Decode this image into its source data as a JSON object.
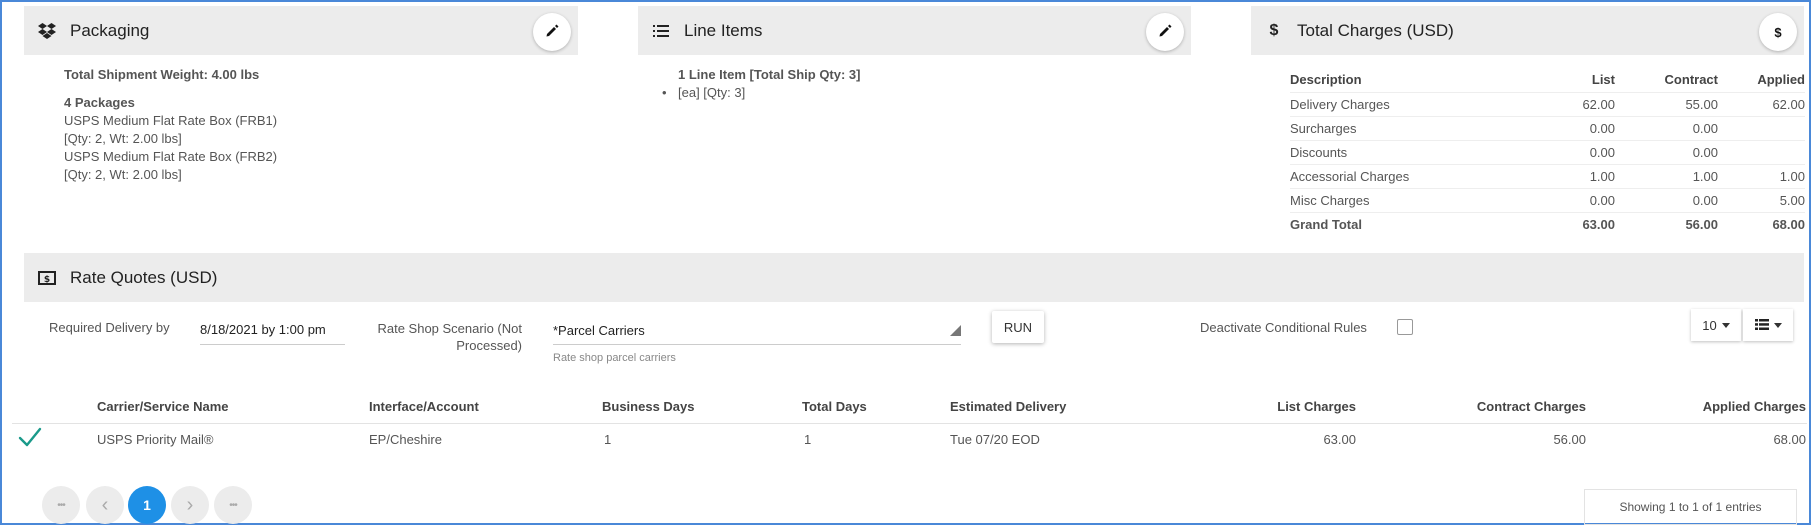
{
  "packaging": {
    "title": "Packaging",
    "total_weight": "Total Shipment Weight: 4.00 lbs",
    "packages_count": "4 Packages",
    "items": [
      {
        "name": "USPS Medium Flat Rate Box (FRB1)",
        "detail": "[Qty: 2, Wt: 2.00 lbs]"
      },
      {
        "name": "USPS Medium Flat Rate Box (FRB2)",
        "detail": "[Qty: 2, Wt: 2.00 lbs]"
      }
    ]
  },
  "line_items": {
    "title": "Line Items",
    "summary": "1 Line Item [Total Ship Qty: 3]",
    "items": [
      "[ea] [Qty: 3]"
    ]
  },
  "total_charges": {
    "title": "Total Charges (USD)",
    "button_symbol": "$",
    "headers": [
      "Description",
      "List",
      "Contract",
      "Applied"
    ],
    "rows": [
      {
        "desc": "Delivery Charges",
        "list": "62.00",
        "contract": "55.00",
        "applied": "62.00",
        "list_link": true,
        "contract_link": true,
        "applied_link": true
      },
      {
        "desc": "Surcharges",
        "list": "0.00",
        "contract": "0.00",
        "applied": "",
        "list_link": false,
        "contract_link": false,
        "applied_link": false
      },
      {
        "desc": "Discounts",
        "list": "0.00",
        "contract": "0.00",
        "applied": "",
        "list_link": false,
        "contract_link": false,
        "applied_link": false
      },
      {
        "desc": "Accessorial Charges",
        "list": "1.00",
        "contract": "1.00",
        "applied": "1.00",
        "list_link": true,
        "contract_link": true,
        "applied_link": true
      },
      {
        "desc": "Misc Charges",
        "list": "0.00",
        "contract": "0.00",
        "applied": "5.00",
        "list_link": false,
        "contract_link": false,
        "applied_link": true
      }
    ],
    "grand_total": {
      "desc": "Grand Total",
      "list": "63.00",
      "contract": "56.00",
      "applied": "68.00"
    }
  },
  "rate_quotes": {
    "title": "Rate Quotes (USD)",
    "required_delivery_label": "Required Delivery by",
    "required_delivery_value": "8/18/2021 by 1:00 pm",
    "scenario_label_1": "Rate Shop Scenario (Not",
    "scenario_label_2": "Processed)",
    "scenario_value": "*Parcel Carriers",
    "scenario_hint": "Rate shop parcel carriers",
    "run_label": "RUN",
    "deactivate_label": "Deactivate Conditional Rules",
    "page_size": "10",
    "columns": {
      "carrier": "Carrier/Service Name",
      "interface": "Interface/Account",
      "business_days": "Business Days",
      "total_days": "Total Days",
      "est_delivery": "Estimated Delivery",
      "list": "List Charges",
      "contract": "Contract Charges",
      "applied": "Applied Charges"
    },
    "rows": [
      {
        "carrier": "USPS Priority Mail®",
        "interface": "EP/Cheshire",
        "business_days": "1",
        "total_days": "1",
        "est_delivery": "Tue 07/20 EOD",
        "list": "63.00",
        "contract": "56.00",
        "applied": "68.00"
      }
    ],
    "pagination": {
      "first": "•••",
      "prev": "‹",
      "current": "1",
      "next": "›",
      "last": "•••"
    },
    "showing": "Showing 1 to 1 of 1 entries"
  },
  "colors": {
    "accent": "#1e90e6",
    "header_bg": "#ececec",
    "check": "#1a9a8a",
    "frame": "#4a88d8"
  }
}
